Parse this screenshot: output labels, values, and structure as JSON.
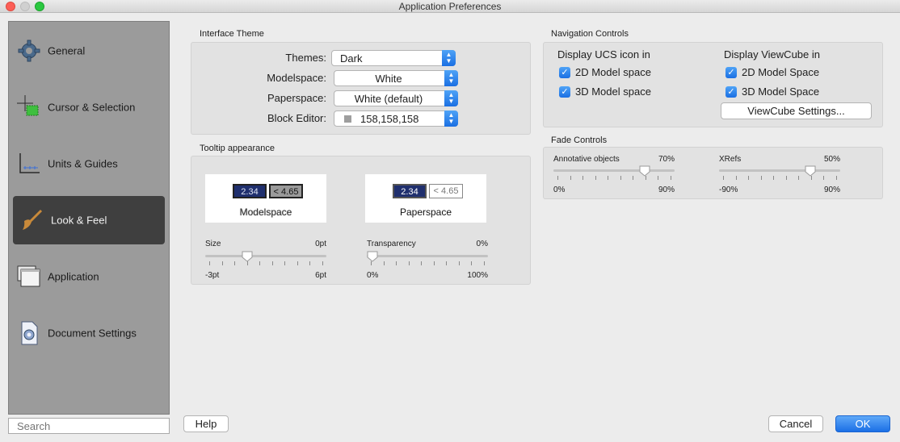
{
  "window": {
    "title": "Application Preferences"
  },
  "sidebar": {
    "items": [
      {
        "label": "General",
        "icon": "gear-icon"
      },
      {
        "label": "Cursor & Selection",
        "icon": "crosshair-icon"
      },
      {
        "label": "Units & Guides",
        "icon": "ruler-icon"
      },
      {
        "label": "Look & Feel",
        "icon": "paintbrush-icon",
        "active": true
      },
      {
        "label": "Application",
        "icon": "windows-icon"
      },
      {
        "label": "Document Settings",
        "icon": "document-gear-icon"
      }
    ],
    "search_placeholder": "Search"
  },
  "interface_theme": {
    "title": "Interface Theme",
    "themes_label": "Themes:",
    "themes_value": "Dark",
    "modelspace_label": "Modelspace:",
    "modelspace_value": "White",
    "paperspace_label": "Paperspace:",
    "paperspace_value": "White (default)",
    "block_editor_label": "Block Editor:",
    "block_editor_value": "158,158,158",
    "block_editor_swatch": "#9e9e9e"
  },
  "tooltip": {
    "title": "Tooltip appearance",
    "model_preview": {
      "value_a": "2.34",
      "value_b": "< 4.65",
      "caption": "Modelspace"
    },
    "paper_preview": {
      "value_a": "2.34",
      "value_b": "< 4.65",
      "caption": "Paperspace"
    },
    "size_slider": {
      "label": "Size",
      "value_label": "0pt",
      "min_label": "-3pt",
      "max_label": "6pt",
      "fraction": 0.333
    },
    "transparency_slider": {
      "label": "Transparency",
      "value_label": "0%",
      "min_label": "0%",
      "max_label": "100%",
      "fraction": 0.0
    }
  },
  "navigation": {
    "title": "Navigation Controls",
    "ucs_title": "Display UCS icon in",
    "ucs_2d": "2D Model space",
    "ucs_3d": "3D Model space",
    "viewcube_title": "Display ViewCube in",
    "viewcube_2d": "2D Model Space",
    "viewcube_3d": "3D Model Space",
    "viewcube_button": "ViewCube Settings..."
  },
  "fade": {
    "title": "Fade Controls",
    "annotative": {
      "label": "Annotative objects",
      "value_label": "70%",
      "min_label": "0%",
      "max_label": "90%",
      "fraction": 0.778
    },
    "xrefs": {
      "label": "XRefs",
      "value_label": "50%",
      "min_label": "-90%",
      "max_label": "90%",
      "fraction": 0.778
    }
  },
  "footer": {
    "help": "Help",
    "cancel": "Cancel",
    "ok": "OK"
  },
  "colors": {
    "accent": "#1b6fe6",
    "sidebar_bg": "#9b9b9b",
    "active_item": "#3f3f3f",
    "tooltip_dark": "#1f2f6e"
  }
}
